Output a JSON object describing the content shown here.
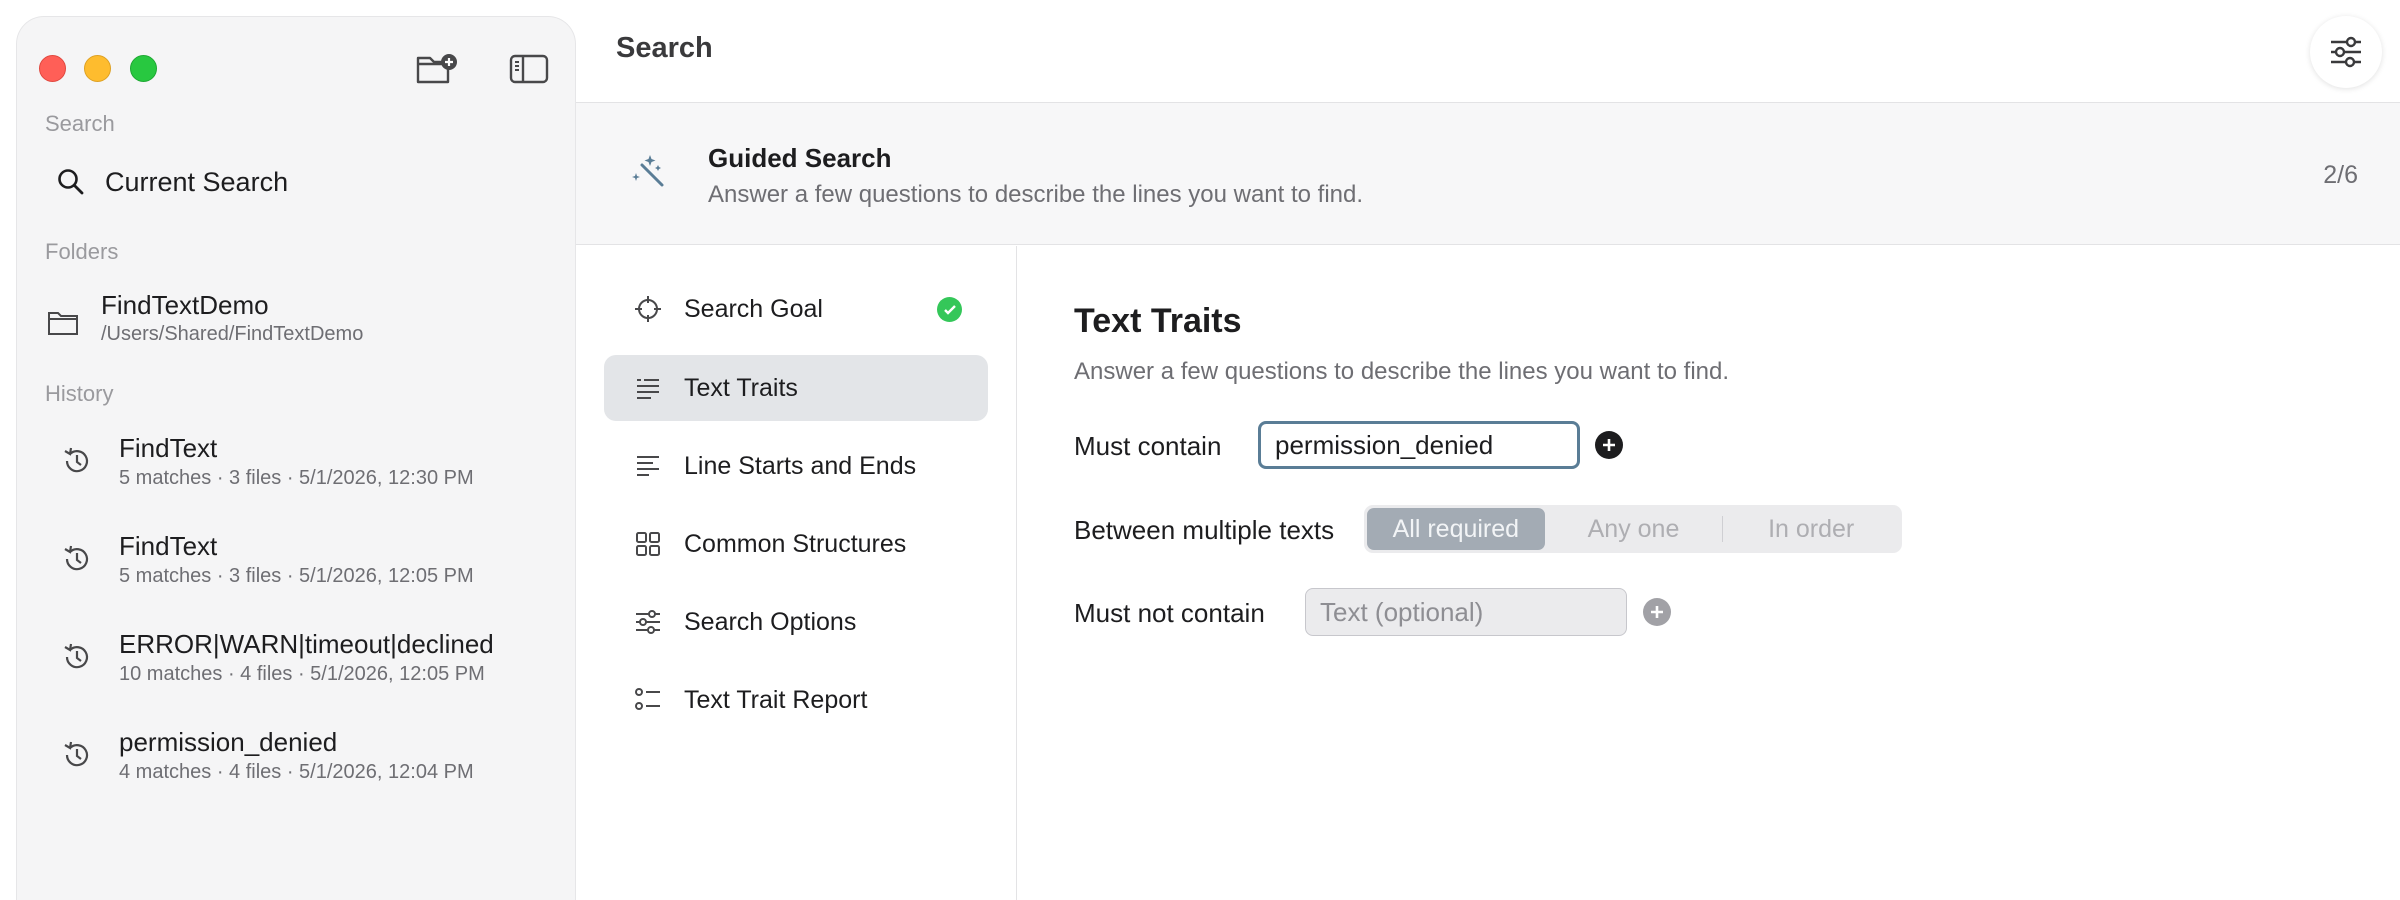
{
  "sidebar": {
    "search_label": "Search",
    "current_search": "Current Search",
    "folders_label": "Folders",
    "folder": {
      "name": "FindTextDemo",
      "path": "/Users/Shared/FindTextDemo"
    },
    "history_label": "History",
    "history": [
      {
        "title": "FindText",
        "sub": "5 matches · 3 files · 5/1/2026, 12:30 PM"
      },
      {
        "title": "FindText",
        "sub": "5 matches · 3 files · 5/1/2026, 12:05 PM"
      },
      {
        "title": "ERROR|WARN|timeout|declined",
        "sub": "10 matches · 4 files · 5/1/2026, 12:05 PM"
      },
      {
        "title": "permission_denied",
        "sub": "4 matches · 4 files · 5/1/2026, 12:04 PM"
      }
    ]
  },
  "header": {
    "title": "Search"
  },
  "banner": {
    "title": "Guided Search",
    "subtitle": "Answer a few questions to describe the lines you want to find.",
    "progress": "2/6"
  },
  "steps": [
    {
      "label": "Search Goal",
      "complete": true
    },
    {
      "label": "Text Traits",
      "active": true
    },
    {
      "label": "Line Starts and Ends"
    },
    {
      "label": "Common Structures"
    },
    {
      "label": "Search Options"
    },
    {
      "label": "Text Trait Report"
    }
  ],
  "content": {
    "title": "Text Traits",
    "subtitle": "Answer a few questions to describe the lines you want to find.",
    "must_contain_label": "Must contain",
    "must_contain_value": "permission_denied",
    "between_label": "Between multiple texts",
    "segments": [
      "All required",
      "Any one",
      "In order"
    ],
    "selected_segment": "All required",
    "must_not_label": "Must not contain",
    "must_not_placeholder": "Text (optional)",
    "must_not_value": ""
  },
  "colors": {
    "accent": "#5a7d96",
    "selected_segment": "#a3abb4",
    "check": "#34c759",
    "close": "#ff5f57",
    "minimize": "#febc2e",
    "maximize": "#28c840"
  }
}
